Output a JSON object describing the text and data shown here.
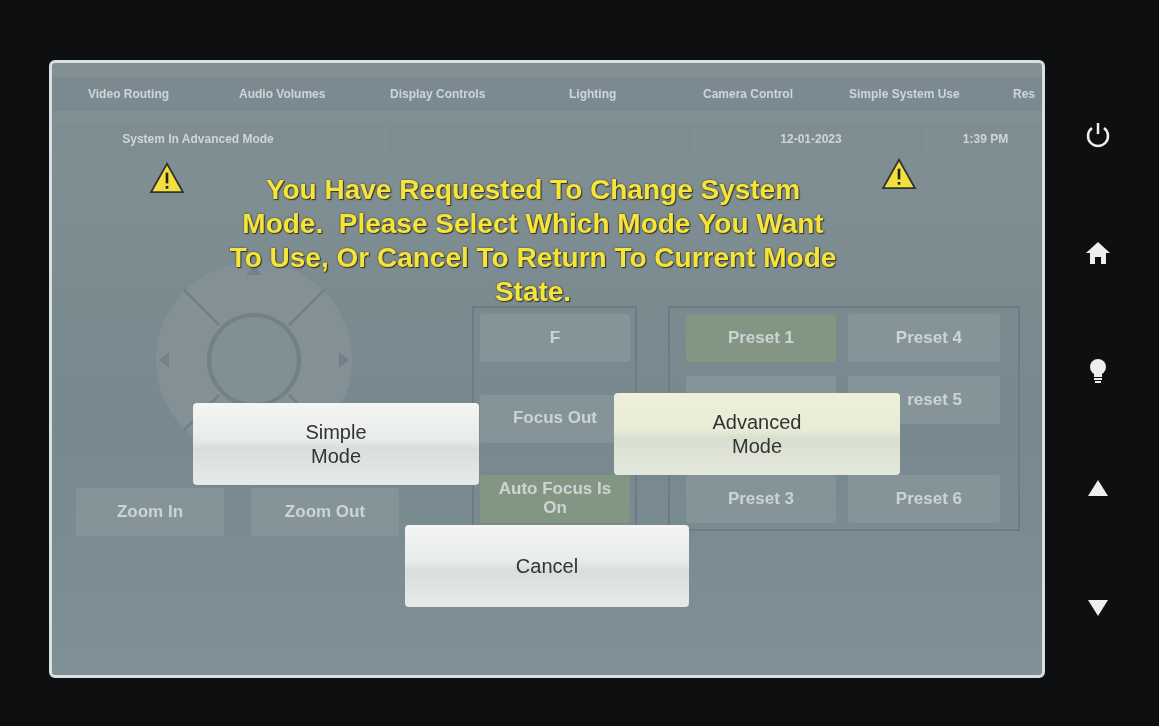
{
  "tabs": [
    {
      "label": "Video Routing"
    },
    {
      "label": "Audio Volumes"
    },
    {
      "label": "Display Controls"
    },
    {
      "label": "Lighting"
    },
    {
      "label": "Camera Control"
    },
    {
      "label": "Simple System Use"
    },
    {
      "label": "Res"
    }
  ],
  "status_bar": {
    "mode": "System In Advanced Mode",
    "date": "12-01-2023",
    "time": "1:39 PM"
  },
  "camera": {
    "zoom_buttons": [
      "Zoom In",
      "Zoom Out"
    ],
    "focus_buttons": [
      {
        "label": "F",
        "active": false
      },
      {
        "label": "Focus Out",
        "active": false
      },
      {
        "label": "Auto Focus Is\nOn",
        "active": true
      }
    ],
    "presets": [
      {
        "label": "Preset 1",
        "active": true
      },
      {
        "label": "Preset 4",
        "active": false
      },
      {
        "active": false
      },
      {
        "label": "reset 5",
        "active": false
      },
      {
        "label": "Preset 3",
        "active": false
      },
      {
        "label": "Preset 6",
        "active": false
      }
    ]
  },
  "dialog": {
    "message": "You Have Requested To Change System\nMode.  Please Select Which Mode You Want\nTo Use, Or Cancel To Return To Current Mode\nState.",
    "buttons": [
      {
        "label": "Simple\nMode",
        "kind": "simple"
      },
      {
        "label": "Advanced\nMode",
        "kind": "advanced"
      },
      {
        "label": "Cancel",
        "kind": "cancel"
      }
    ]
  }
}
